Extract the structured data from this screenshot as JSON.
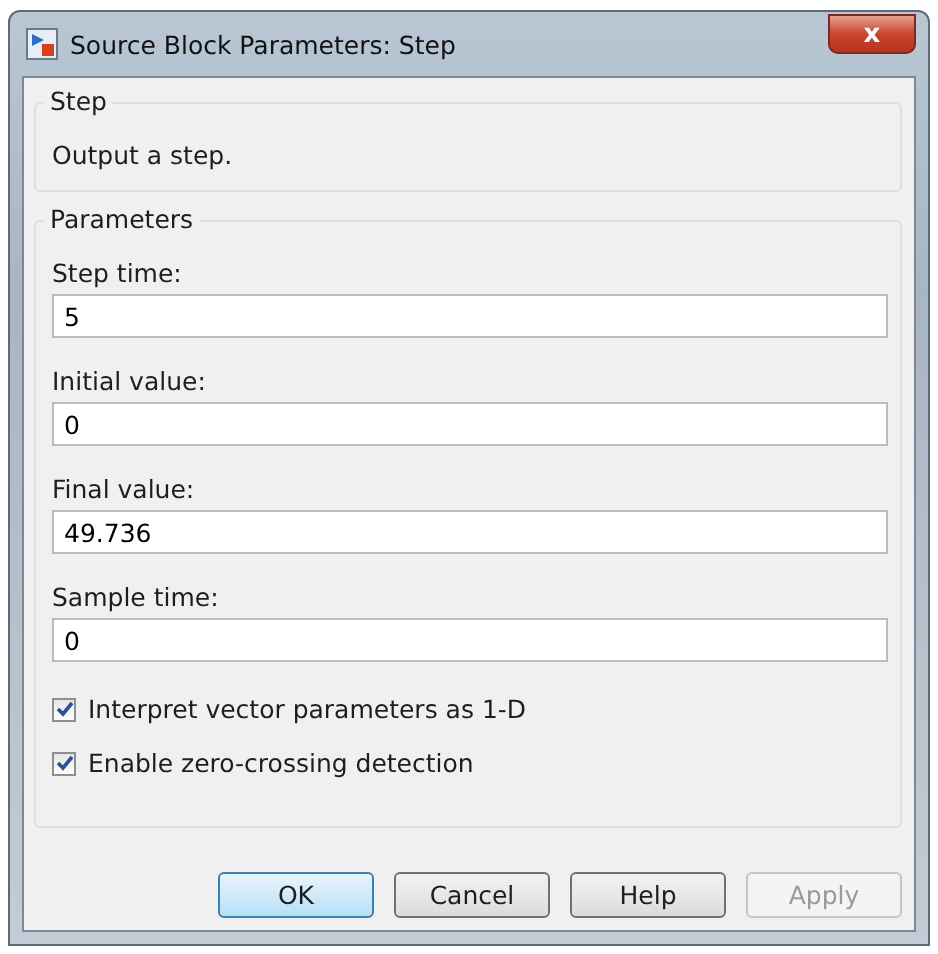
{
  "window": {
    "title": "Source Block Parameters: Step",
    "close": "x"
  },
  "description_group": {
    "title": "Step",
    "text": "Output a step."
  },
  "parameters_group": {
    "title": "Parameters",
    "fields": [
      {
        "label": "Step time:",
        "value": "5"
      },
      {
        "label": "Initial value:",
        "value": "0"
      },
      {
        "label": "Final value:",
        "value": "49.736"
      },
      {
        "label": "Sample time:",
        "value": "0"
      }
    ],
    "checkboxes": [
      {
        "label": "Interpret vector parameters as 1-D",
        "checked": true
      },
      {
        "label": "Enable zero-crossing detection",
        "checked": true
      }
    ]
  },
  "buttons": [
    {
      "label": "OK",
      "default": true,
      "disabled": false
    },
    {
      "label": "Cancel",
      "default": false,
      "disabled": false
    },
    {
      "label": "Help",
      "default": false,
      "disabled": false
    },
    {
      "label": "Apply",
      "default": false,
      "disabled": true
    }
  ]
}
